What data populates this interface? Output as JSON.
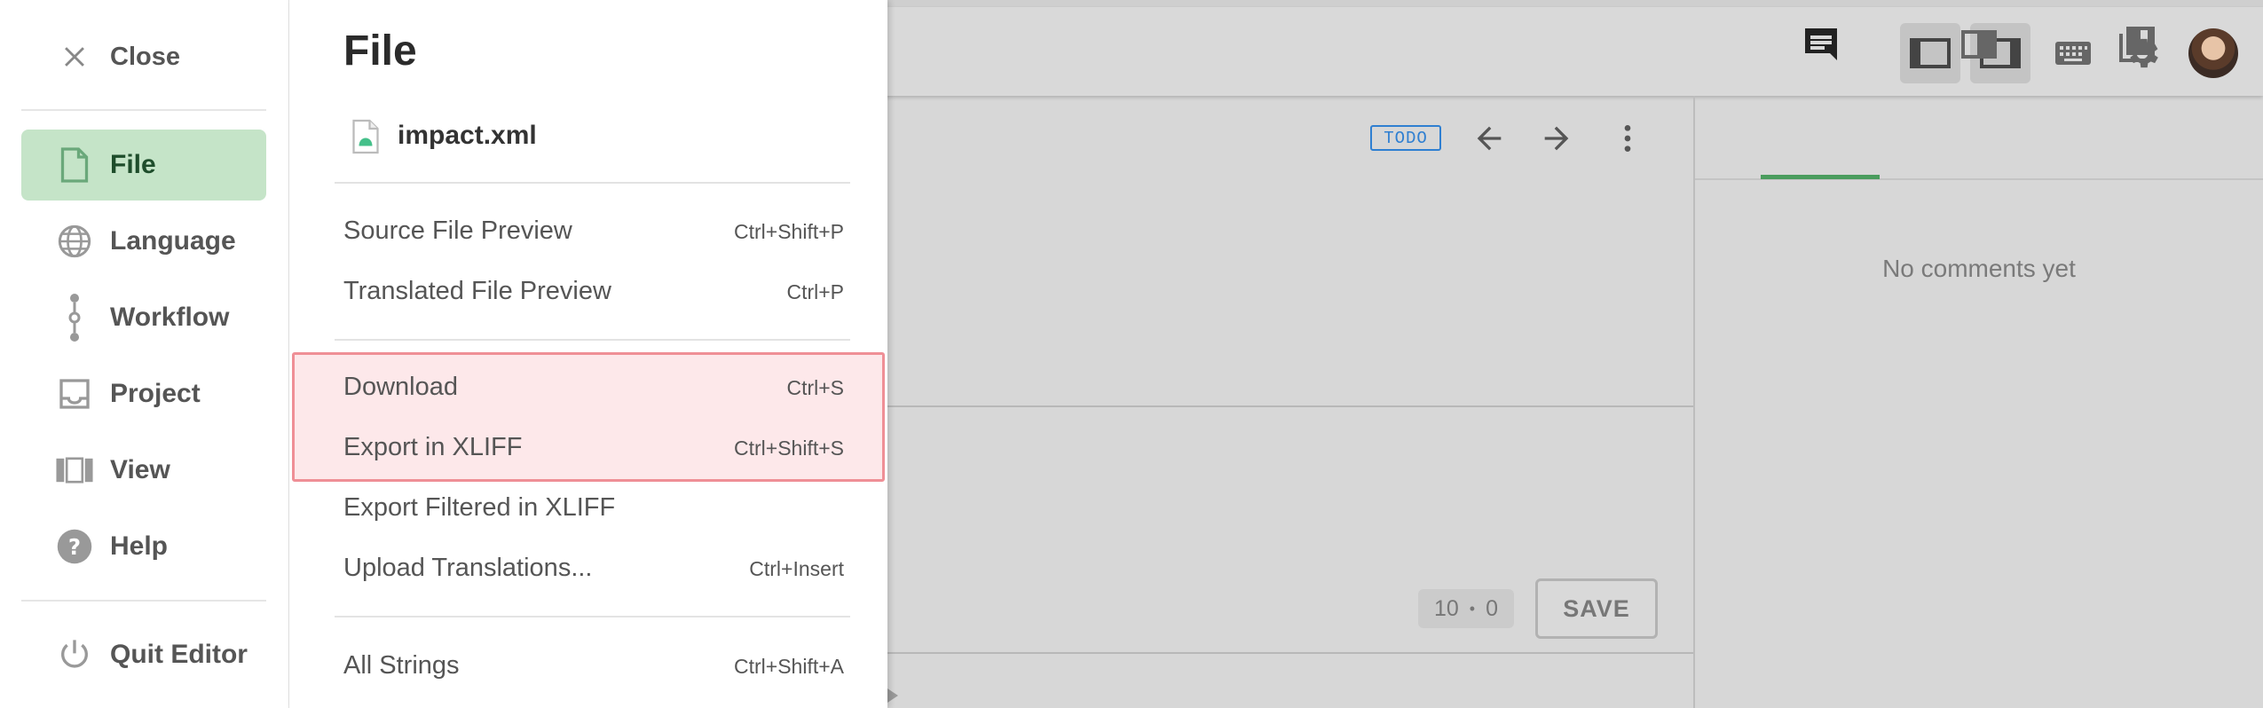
{
  "left_nav": {
    "close_label": "Close",
    "items": [
      {
        "label": "File",
        "icon": "file-icon",
        "active": true
      },
      {
        "label": "Language",
        "icon": "globe-icon",
        "active": false
      },
      {
        "label": "Workflow",
        "icon": "workflow-icon",
        "active": false
      },
      {
        "label": "Project",
        "icon": "inbox-icon",
        "active": false
      },
      {
        "label": "View",
        "icon": "view-columns-icon",
        "active": false
      },
      {
        "label": "Help",
        "icon": "help-icon",
        "active": false
      }
    ],
    "quit_label": "Quit Editor"
  },
  "file_menu": {
    "title": "File",
    "file_name": "impact.xml",
    "items": [
      {
        "label": "Source File Preview",
        "shortcut": "Ctrl+Shift+P"
      },
      {
        "label": "Translated File Preview",
        "shortcut": "Ctrl+P"
      },
      {
        "label": "Download",
        "shortcut": "Ctrl+S"
      },
      {
        "label": "Export in XLIFF",
        "shortcut": "Ctrl+Shift+S"
      },
      {
        "label": "Export Filtered in XLIFF",
        "shortcut": ""
      },
      {
        "label": "Upload Translations...",
        "shortcut": "Ctrl+Insert"
      },
      {
        "label": "All Strings",
        "shortcut": "Ctrl+Shift+A"
      }
    ]
  },
  "editor": {
    "status_badge": "TODO",
    "counter_left": "10",
    "counter_sep": "•",
    "counter_right": "0",
    "save_label": "SAVE"
  },
  "right_panel": {
    "empty_text": "No comments yet"
  },
  "colors": {
    "active_nav_bg": "#c5e4c8",
    "highlight_bg": "#fde8ea",
    "highlight_border": "#ef8f96",
    "accent_green": "#4a9c5d",
    "badge_blue": "#2f7fd1"
  }
}
